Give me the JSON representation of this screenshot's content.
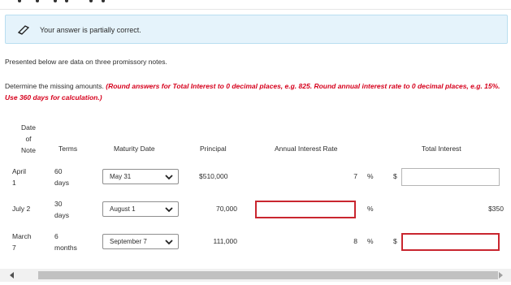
{
  "banner": {
    "message": "Your answer is partially correct."
  },
  "intro": "Presented below are data on three promissory notes.",
  "instruction": {
    "prefix": "Determine the missing amounts.",
    "emphasis": "(Round answers for Total Interest to 0 decimal places, e.g. 825. Round annual interest rate to 0 decimal places, e.g. 15%. Use 360 days for calculation.)"
  },
  "table": {
    "headers": {
      "date_line1": "Date",
      "date_line2": "of",
      "date_line3": "Note",
      "terms": "Terms",
      "maturity": "Maturity Date",
      "principal": "Principal",
      "rate": "Annual Interest Rate",
      "interest": "Total Interest"
    },
    "rows": [
      {
        "date_line1": "April",
        "date_line2": "1",
        "terms_line1": "60",
        "terms_line2": "days",
        "maturity": "May 31",
        "principal": "$510,000",
        "rate": "7",
        "rate_unit": "%",
        "interest_prefix": "$",
        "interest": ""
      },
      {
        "date_line1": "July 2",
        "date_line2": "",
        "terms_line1": "30",
        "terms_line2": "days",
        "maturity": "August 1",
        "principal": "70,000",
        "rate": "",
        "rate_unit": "%",
        "interest_prefix": "",
        "interest": "$350"
      },
      {
        "date_line1": "March",
        "date_line2": "7",
        "terms_line1": "6",
        "terms_line2": "months",
        "maturity": "September 7",
        "principal": "111,000",
        "rate": "8",
        "rate_unit": "%",
        "interest_prefix": "$",
        "interest": ""
      }
    ]
  },
  "icons": {
    "banner": "pencil-icon",
    "dropdown": "chevron-down-icon",
    "scroll_left": "arrow-left-icon",
    "scroll_right": "arrow-right-icon"
  },
  "colors": {
    "banner_bg": "#e5f3fb",
    "instruction_red": "#d6001c",
    "error_border": "#c9262f"
  }
}
